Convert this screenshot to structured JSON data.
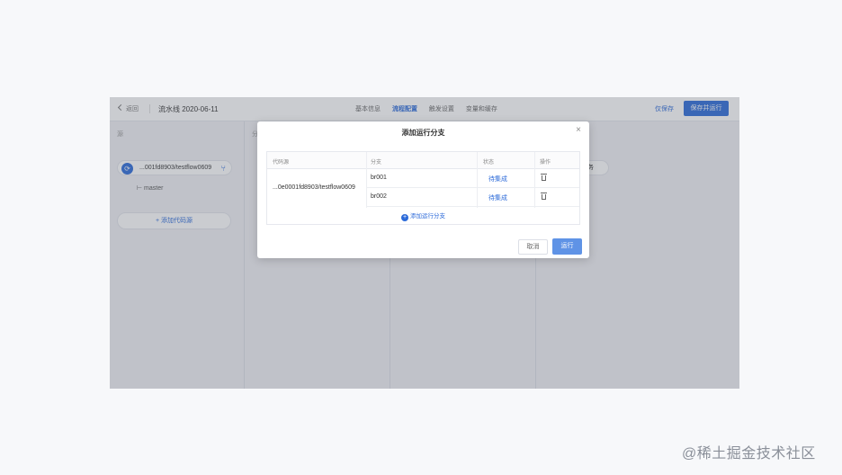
{
  "header": {
    "back_label": "返回",
    "pipeline_title": "流水线 2020-06-11",
    "tabs": [
      {
        "label": "基本信息",
        "active": false
      },
      {
        "label": "流程配置",
        "active": true
      },
      {
        "label": "触发设置",
        "active": false
      },
      {
        "label": "变量和缓存",
        "active": false
      }
    ],
    "save_label": "仅保存",
    "save_run_label": "保存并运行"
  },
  "canvas": {
    "source_section_label": "源",
    "stage2_label": "分",
    "repo_chip_label": "...001fd8903/testflow0609",
    "branch_label": "master",
    "add_source_label": "添加代码源",
    "task_chip_label": "务"
  },
  "modal": {
    "title": "添加运行分支",
    "columns": [
      "代码源",
      "分支",
      "状态",
      "操作"
    ],
    "repo_name": "...0e0001fd8903/testflow0609",
    "rows": [
      {
        "branch": "br001",
        "status": "待集成"
      },
      {
        "branch": "br002",
        "status": "待集成"
      }
    ],
    "add_branch_label": "添加运行分支",
    "cancel_label": "取消",
    "run_label": "运行"
  },
  "watermark": "@稀土掘金技术社区",
  "colors": {
    "primary": "#2c6ad9",
    "run_button": "#5f93e6",
    "mask": "#5a5f6e"
  }
}
